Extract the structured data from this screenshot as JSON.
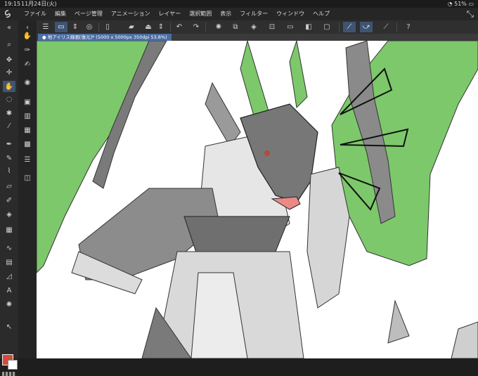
{
  "status_bar": {
    "time": "19:15",
    "date": "11月24日(火)",
    "battery": "51%"
  },
  "menu": {
    "items": [
      "ファイル",
      "編集",
      "ページ管理",
      "アニメーション",
      "レイヤー",
      "選択範囲",
      "表示",
      "フィルター",
      "ウィンドウ",
      "ヘルプ"
    ]
  },
  "document": {
    "tab_title": "● 地アイリス線画[復元]* (5000 x 5000px 350dpi 53.8%)"
  },
  "toolbar": {
    "icons": [
      "menu-icon",
      "new-canvas-icon",
      "stepper-icon",
      "view-icon",
      "new-file-icon",
      "open-file-icon",
      "save-icon",
      "stepper-icon",
      "undo-icon",
      "redo-icon",
      "loading-icon",
      "copy-icon",
      "fill-icon",
      "transform-icon",
      "select-all-icon",
      "invert-selection-icon",
      "clear-selection-icon",
      "stabilizer-icon",
      "snap-icon",
      "ruler-icon",
      "help-icon"
    ]
  },
  "colors": {
    "main": "#d44a3a",
    "sub": "#ffffff",
    "tab": "#4b6ea3",
    "active_tool": "#3f5472"
  }
}
